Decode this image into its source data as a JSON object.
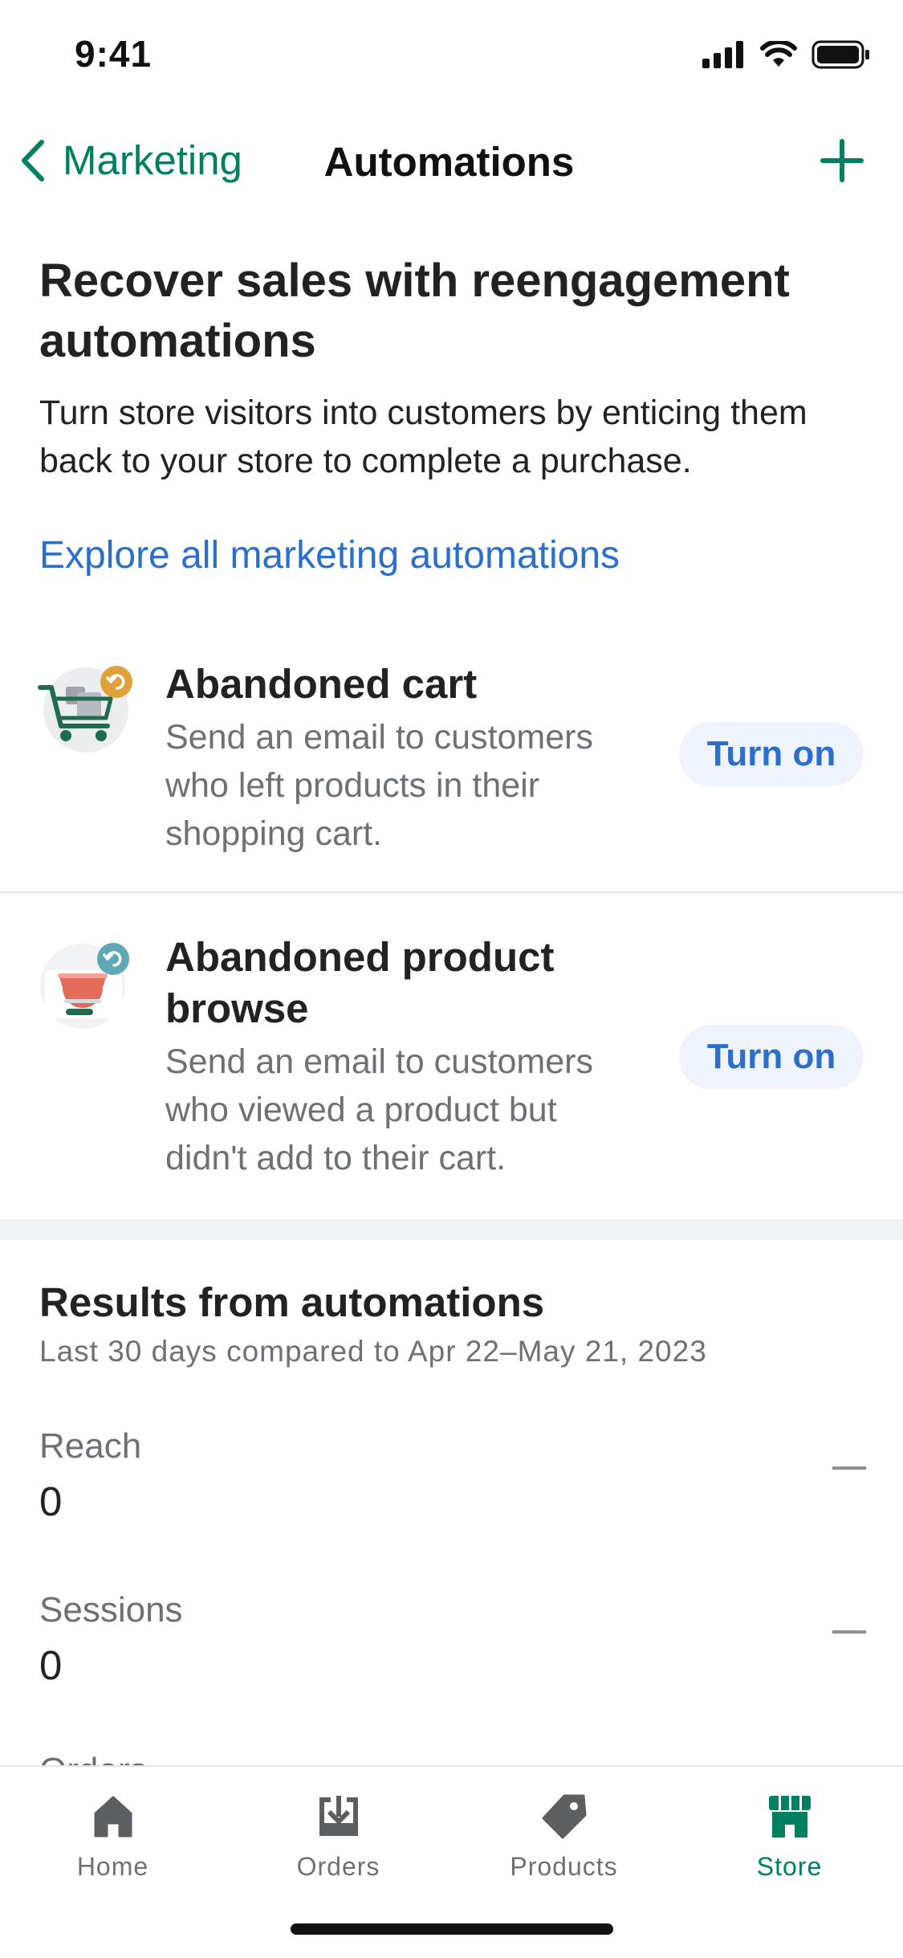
{
  "status_bar": {
    "time": "9:41"
  },
  "nav": {
    "back_label": "Marketing",
    "title": "Automations"
  },
  "hero": {
    "title": "Recover sales with reengagement automations",
    "description": "Turn store visitors into customers by enticing them back to your store to complete a purchase.",
    "link": "Explore all marketing automations"
  },
  "automations": [
    {
      "title": "Abandoned cart",
      "description": "Send an email to customers who left products in their shopping cart.",
      "button": "Turn on",
      "icon": "abandoned-cart-icon"
    },
    {
      "title": "Abandoned product browse",
      "description": "Send an email to customers who viewed a product but didn't add to their cart.",
      "button": "Turn on",
      "icon": "abandoned-browse-icon"
    }
  ],
  "results": {
    "title": "Results from automations",
    "subtitle": "Last 30 days compared to Apr 22–May 21, 2023",
    "metrics": [
      {
        "label": "Reach",
        "value": "0",
        "trend": "none"
      },
      {
        "label": "Sessions",
        "value": "0",
        "trend": "none"
      }
    ],
    "partial_label": "Orders"
  },
  "tab_bar": {
    "tabs": [
      {
        "label": "Home",
        "icon": "home-icon"
      },
      {
        "label": "Orders",
        "icon": "orders-icon"
      },
      {
        "label": "Products",
        "icon": "tag-icon"
      },
      {
        "label": "Store",
        "icon": "store-icon",
        "active": true
      }
    ]
  },
  "colors": {
    "brand_green": "#008060",
    "link_blue": "#2c6ecb",
    "subdued_text": "#6d7175",
    "button_bg": "#eef3fc"
  }
}
